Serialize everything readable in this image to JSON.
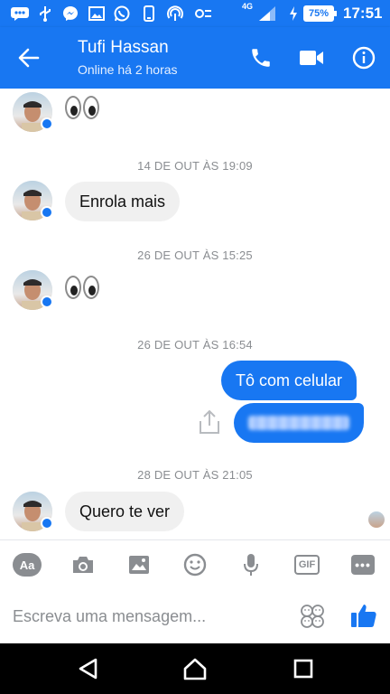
{
  "statusbar": {
    "network": "4G",
    "battery": "75%",
    "time": "17:51"
  },
  "header": {
    "contact_name": "Tufi Hassan",
    "contact_status": "Online há 2 horas"
  },
  "chat": {
    "timestamps": [
      "14 DE OUT ÀS 19:09",
      "26 DE OUT ÀS 15:25",
      "26 DE OUT ÀS 16:54",
      "28 DE OUT ÀS 21:05"
    ],
    "messages": {
      "m1": "Enrola mais",
      "m2": "Tô com celular",
      "m3": "Quero te ver"
    }
  },
  "toolbar": {
    "aa_label": "Aa",
    "gif_label": "GIF",
    "more_label": "•••"
  },
  "compose": {
    "placeholder": "Escreva uma mensagem..."
  },
  "colors": {
    "accent": "#1877f2",
    "bubble_in": "#f0f0f0",
    "muted": "#8a8d91"
  }
}
